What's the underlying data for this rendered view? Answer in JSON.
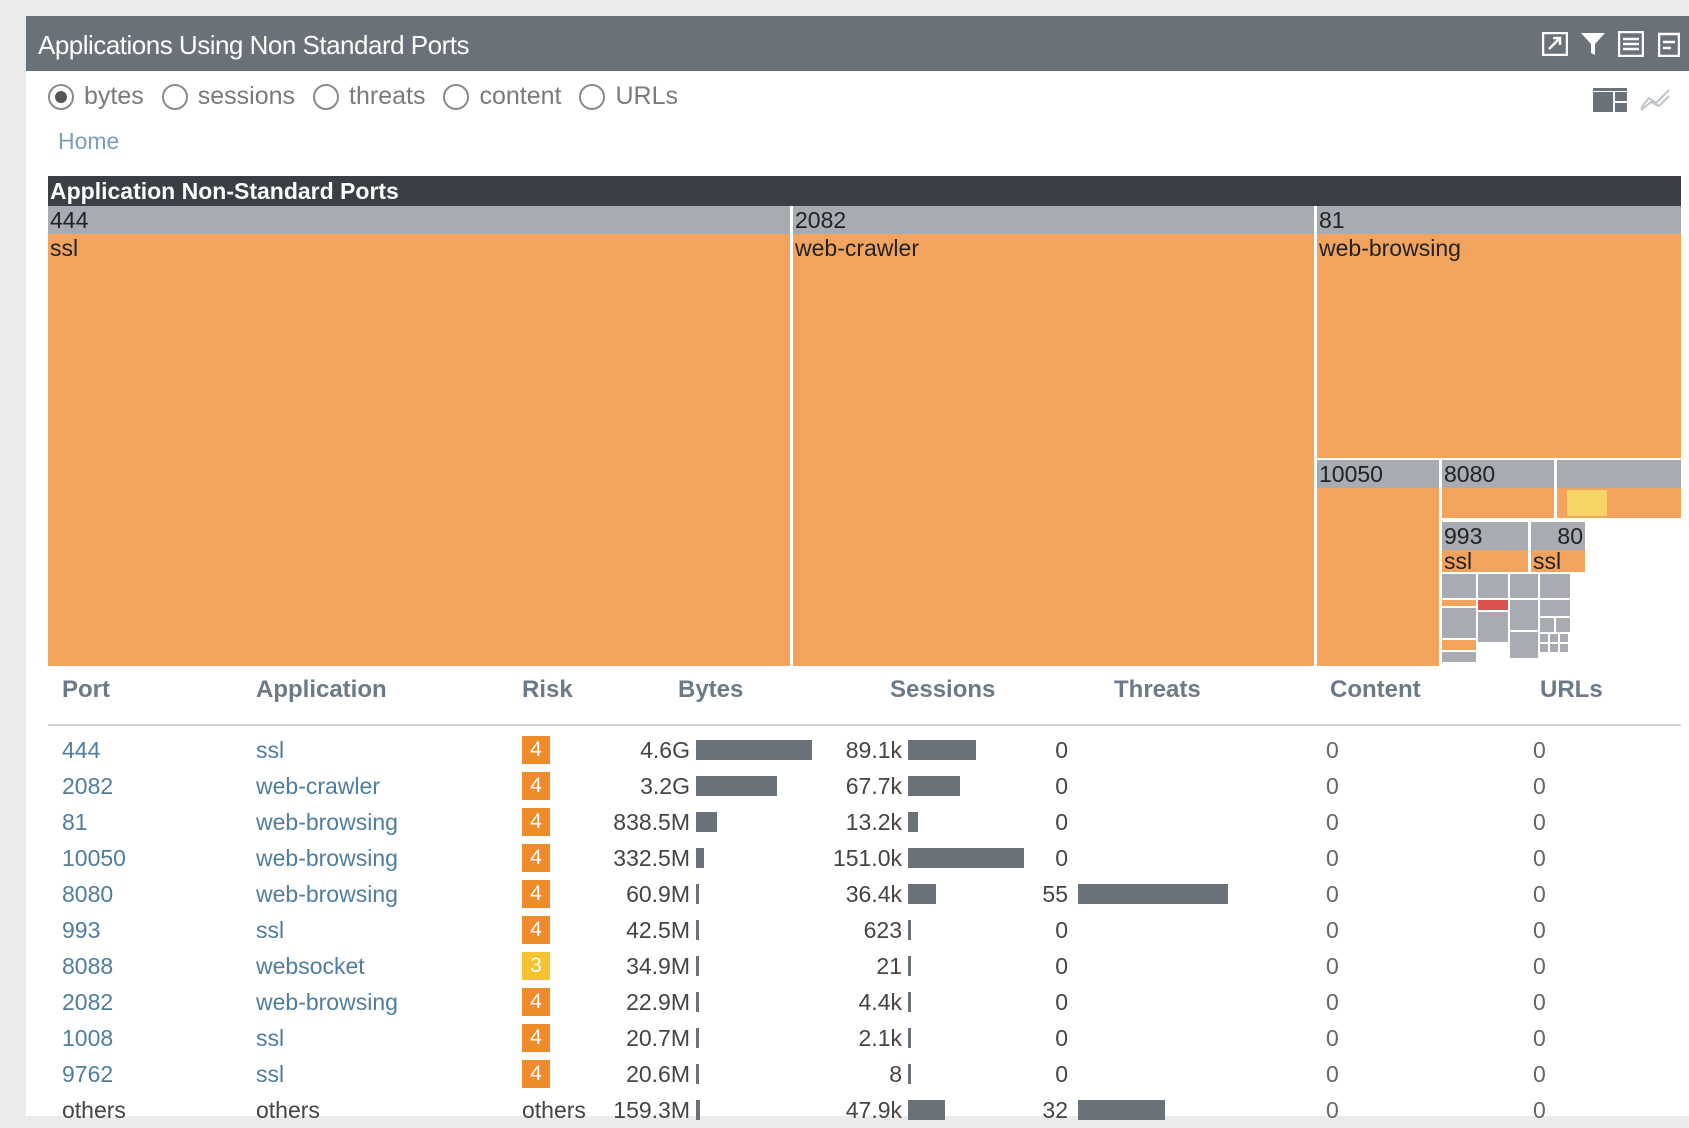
{
  "title": "Applications Using Non Standard Ports",
  "toolbar_icons": [
    "expand-icon",
    "filter-icon",
    "list-icon",
    "export-icon"
  ],
  "radios": [
    {
      "label": "bytes",
      "selected": true
    },
    {
      "label": "sessions",
      "selected": false
    },
    {
      "label": "threats",
      "selected": false
    },
    {
      "label": "content",
      "selected": false
    },
    {
      "label": "URLs",
      "selected": false
    }
  ],
  "breadcrumb": "Home",
  "treemap": {
    "title": "Application Non-Standard Ports",
    "blocks": [
      {
        "port": "444",
        "app": "ssl"
      },
      {
        "port": "2082",
        "app": "web-crawler"
      },
      {
        "port": "81",
        "app": "web-browsing"
      },
      {
        "port": "10050",
        "app": ""
      },
      {
        "port": "8080",
        "app": ""
      },
      {
        "port": "993",
        "app": "ssl"
      },
      {
        "port": "80",
        "app": "ssl"
      }
    ]
  },
  "table": {
    "columns": [
      "Port",
      "Application",
      "Risk",
      "Bytes",
      "Sessions",
      "Threats",
      "Content",
      "URLs"
    ],
    "rows": [
      {
        "port": "444",
        "app": "ssl",
        "risk": "4",
        "bytes": "4.6G",
        "bytes_val": 4600,
        "sessions": "89.1k",
        "sessions_val": 89.1,
        "threats": "0",
        "threats_val": 0,
        "content": "0",
        "urls": "0"
      },
      {
        "port": "2082",
        "app": "web-crawler",
        "risk": "4",
        "bytes": "3.2G",
        "bytes_val": 3200,
        "sessions": "67.7k",
        "sessions_val": 67.7,
        "threats": "0",
        "threats_val": 0,
        "content": "0",
        "urls": "0"
      },
      {
        "port": "81",
        "app": "web-browsing",
        "risk": "4",
        "bytes": "838.5M",
        "bytes_val": 838.5,
        "sessions": "13.2k",
        "sessions_val": 13.2,
        "threats": "0",
        "threats_val": 0,
        "content": "0",
        "urls": "0"
      },
      {
        "port": "10050",
        "app": "web-browsing",
        "risk": "4",
        "bytes": "332.5M",
        "bytes_val": 332.5,
        "sessions": "151.0k",
        "sessions_val": 151.0,
        "threats": "0",
        "threats_val": 0,
        "content": "0",
        "urls": "0"
      },
      {
        "port": "8080",
        "app": "web-browsing",
        "risk": "4",
        "bytes": "60.9M",
        "bytes_val": 60.9,
        "sessions": "36.4k",
        "sessions_val": 36.4,
        "threats": "55",
        "threats_val": 55,
        "content": "0",
        "urls": "0"
      },
      {
        "port": "993",
        "app": "ssl",
        "risk": "4",
        "bytes": "42.5M",
        "bytes_val": 42.5,
        "sessions": "623",
        "sessions_val": 0.623,
        "threats": "0",
        "threats_val": 0,
        "content": "0",
        "urls": "0"
      },
      {
        "port": "8088",
        "app": "websocket",
        "risk": "3",
        "bytes": "34.9M",
        "bytes_val": 34.9,
        "sessions": "21",
        "sessions_val": 0.021,
        "threats": "0",
        "threats_val": 0,
        "content": "0",
        "urls": "0"
      },
      {
        "port": "2082",
        "app": "web-browsing",
        "risk": "4",
        "bytes": "22.9M",
        "bytes_val": 22.9,
        "sessions": "4.4k",
        "sessions_val": 4.4,
        "threats": "0",
        "threats_val": 0,
        "content": "0",
        "urls": "0"
      },
      {
        "port": "1008",
        "app": "ssl",
        "risk": "4",
        "bytes": "20.7M",
        "bytes_val": 20.7,
        "sessions": "2.1k",
        "sessions_val": 2.1,
        "threats": "0",
        "threats_val": 0,
        "content": "0",
        "urls": "0"
      },
      {
        "port": "9762",
        "app": "ssl",
        "risk": "4",
        "bytes": "20.6M",
        "bytes_val": 20.6,
        "sessions": "8",
        "sessions_val": 0.008,
        "threats": "0",
        "threats_val": 0,
        "content": "0",
        "urls": "0"
      },
      {
        "port": "others",
        "app": "others",
        "risk": "others",
        "bytes": "159.3M",
        "bytes_val": 159.3,
        "sessions": "47.9k",
        "sessions_val": 47.9,
        "threats": "32",
        "threats_val": 32,
        "content": "0",
        "urls": "0"
      }
    ]
  },
  "colors": {
    "titlebar": "#6b7179",
    "treemap_header": "#3a3f46",
    "port_cell": "#a8acb2",
    "app_cell": "#f2a35e",
    "risk4": "#ee8b2a",
    "risk3": "#f5c230",
    "bar": "#6b7179",
    "link": "#4f7d9e"
  }
}
